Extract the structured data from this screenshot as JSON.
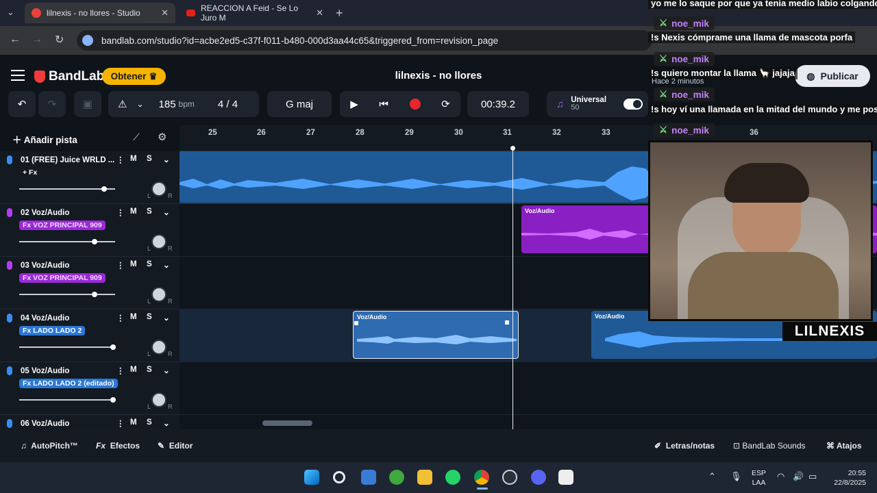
{
  "browser": {
    "tabs": [
      {
        "title": "lilnexis - no llores - Studio"
      },
      {
        "title": "REACCION A Feid - Se Lo Juro M"
      }
    ],
    "url": "bandlab.com/studio?id=acbe2ed5-c37f-f011-b480-000d3aa44c65&triggered_from=revision_page"
  },
  "app": {
    "logo": "BandLab",
    "obtener": "Obtener",
    "project_title": "lilnexis - no llores",
    "publicar": "Publicar",
    "tempo": "185",
    "tempo_unit": "bpm",
    "time_sig": "4 / 4",
    "key": "G maj",
    "time": "00:39.2",
    "preset_name": "Universal",
    "preset_value": "50",
    "add_track": "Añadir pista"
  },
  "ruler": [
    "25",
    "26",
    "27",
    "28",
    "29",
    "30",
    "31",
    "32",
    "33",
    "36"
  ],
  "tracks": [
    {
      "name": "01  (FREE) Juice WRLD ...",
      "fx": "+ Fx",
      "mic_color": "#3b8cf0",
      "fx_style": "plain",
      "volume": 0.88
    },
    {
      "name": "02  Voz/Audio",
      "fx": "Fx VOZ PRINCIPAL 909",
      "mic_color": "#b43cf0",
      "fx_style": "purple",
      "volume": 0.78
    },
    {
      "name": "03  Voz/Audio",
      "fx": "Fx VOZ PRINCIPAL 909",
      "mic_color": "#b43cf0",
      "fx_style": "purple",
      "volume": 0.78
    },
    {
      "name": "04  Voz/Audio",
      "fx": "Fx LADO LADO 2",
      "mic_color": "#3b8cf0",
      "fx_style": "blue",
      "volume": 0.98
    },
    {
      "name": "05  Voz/Audio",
      "fx": "Fx LADO LADO 2 (editado)",
      "mic_color": "#3b8cf0",
      "fx_style": "blue",
      "volume": 0.98
    },
    {
      "name": "06  Voz/Audio",
      "fx": "",
      "mic_color": "#3b8cf0",
      "fx_style": "none",
      "volume": 0
    }
  ],
  "track_buttons": {
    "mute": "M",
    "solo": "S",
    "left": "L",
    "right": "R"
  },
  "regions": {
    "label": "Voz/Audio"
  },
  "bottom": {
    "autopitch": "AutoPitch™",
    "efectos": "Efectos",
    "editor": "Editor",
    "letras": "Letras/notas",
    "sounds": "BandLab Sounds",
    "atajos": "Atajos"
  },
  "taskbar": {
    "lang_top": "ESP",
    "lang_bottom": "LAA",
    "time": "20:55",
    "date": "22/8/2025"
  },
  "chat": {
    "top_line": "yo me lo saque por que ya tenia medio labio colgando",
    "messages": [
      {
        "user": "noe_mik",
        "text": "!s Nexis cómprame una llama de mascota porfa"
      },
      {
        "user": "noe_mik",
        "text": "!s quiero montar la llama 🦙 jajaja"
      },
      {
        "user": "noe_mik",
        "text": "!s hoy ví una llamada en la mitad del mundo y me poso"
      },
      {
        "user": "noe_mik",
        "text": ""
      }
    ],
    "time_ago": "Hace 2 minutos"
  },
  "stream_name": "LILNEXIS"
}
